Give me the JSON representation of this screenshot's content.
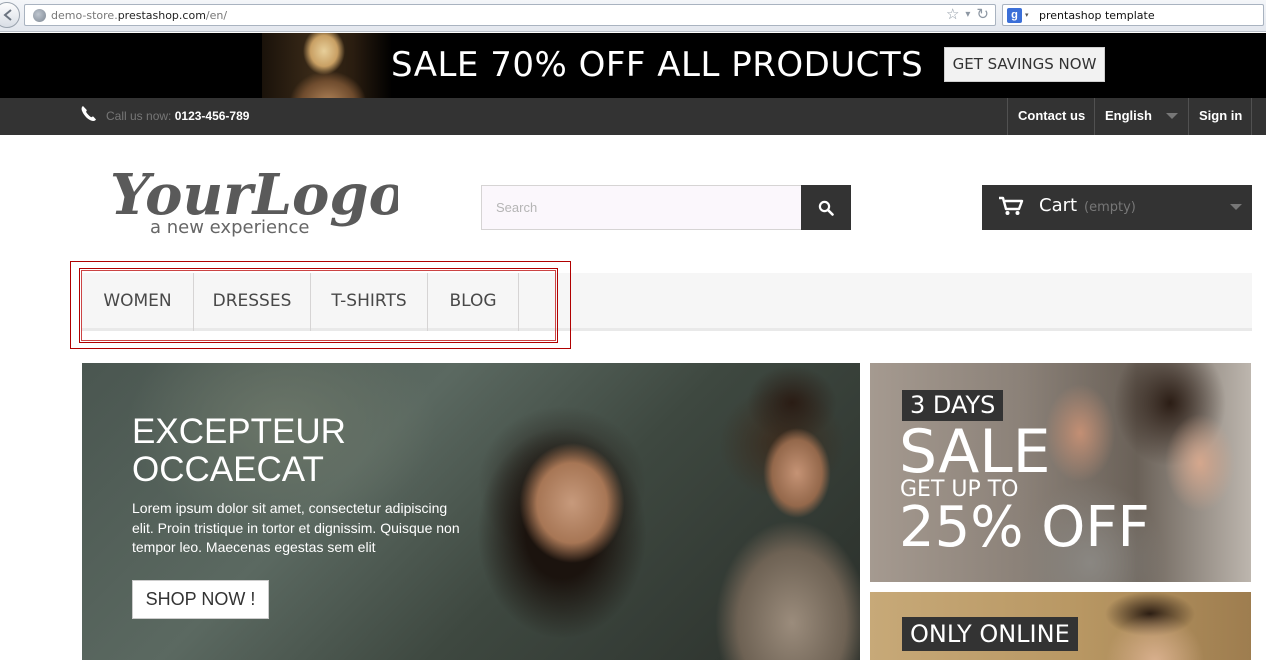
{
  "browser": {
    "url_prefix": "demo-store.",
    "url_domain": "prestashop.com",
    "url_suffix": "/en/",
    "search_text": "prentashop template",
    "search_engine_icon": "g-icon"
  },
  "promo": {
    "text": "SALE 70% OFF ALL PRODUCTS",
    "button": "GET SAVINGS NOW"
  },
  "topnav": {
    "call_label": "Call us now:",
    "phone": "0123-456-789",
    "contact": "Contact us",
    "language": "English",
    "signin": "Sign in"
  },
  "logo": {
    "text": "YourLogo",
    "tagline": "a new experience"
  },
  "search": {
    "placeholder": "Search"
  },
  "cart": {
    "label": "Cart",
    "status": "(empty)"
  },
  "menu": {
    "items": [
      "WOMEN",
      "DRESSES",
      "T-SHIRTS",
      "BLOG"
    ]
  },
  "slider": {
    "title_line1": "EXCEPTEUR",
    "title_line2": "OCCAECAT",
    "text": "Lorem ipsum dolor sit amet, consectetur adipiscing elit. Proin tristique in tortor et dignissim. Quisque non tempor leo. Maecenas egestas sem elit",
    "button": "SHOP NOW !"
  },
  "banner1": {
    "days": "3 DAYS",
    "sale": "SALE",
    "getup": "GET UP TO",
    "off": "25% OFF"
  },
  "banner2": {
    "label": "ONLY ONLINE"
  },
  "colors": {
    "dark": "#333333",
    "highlight": "#b00000"
  }
}
